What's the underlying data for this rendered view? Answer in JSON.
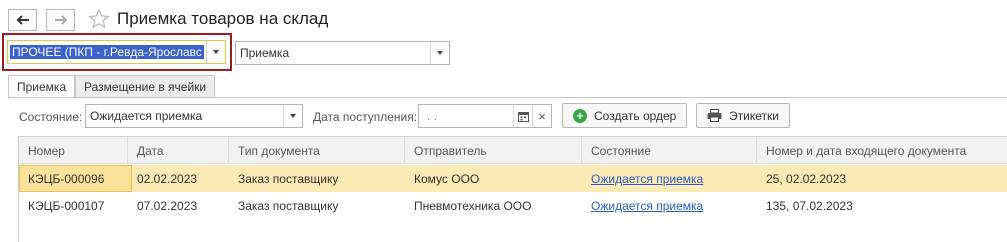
{
  "window": {
    "title": "Приемка товаров на склад",
    "back_icon": "arrow-left-icon",
    "forward_icon": "arrow-right-icon",
    "favorite_icon": "star-icon"
  },
  "filters_top": {
    "warehouse_value": "ПРОЧЕЕ (ПКП - г.Ревда-Ярославс",
    "operation_value": "Приемка"
  },
  "tabs": [
    {
      "label": "Приемка",
      "active": true
    },
    {
      "label": "Размещение в ячейки",
      "active": false
    }
  ],
  "filter_row": {
    "state_label": "Состояние:",
    "state_value": "Ожидается приемка",
    "date_label": "Дата поступления:",
    "date_value": ". .",
    "create_order_label": "Создать ордер",
    "labels_button": "Этикетки"
  },
  "table": {
    "columns": [
      "Номер",
      "Дата",
      "Тип документа",
      "Отправитель",
      "Состояние",
      "Номер и дата входящего документа"
    ],
    "rows": [
      [
        "КЭЦБ-000096",
        "02.02.2023",
        "Заказ поставщику",
        "Комус ООО",
        "Ожидается приемка",
        "25, 02.02.2023"
      ],
      [
        "КЭЦБ-000107",
        "07.02.2023",
        "Заказ поставщику",
        "Пневмотехника ООО",
        "Ожидается приемка",
        "135, 07.02.2023"
      ]
    ]
  },
  "colors": {
    "selection_text_bg": "#3a62cc",
    "highlight_frame": "#9c1e22",
    "selected_row": "#fbeab5",
    "link": "#2a5bc4",
    "create_icon": "#3aa845"
  }
}
